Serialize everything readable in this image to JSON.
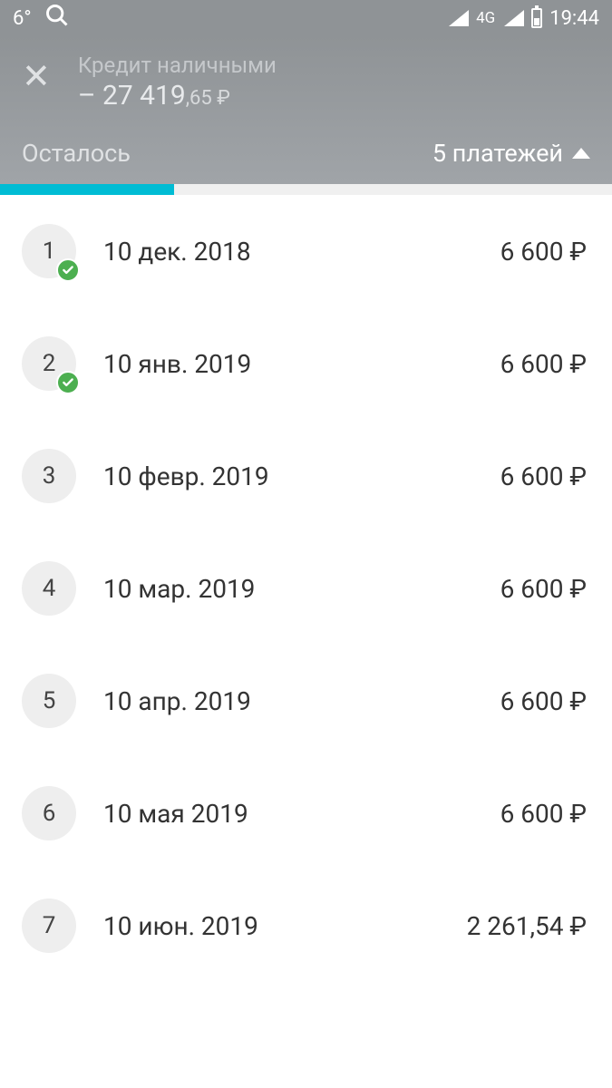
{
  "status_bar": {
    "temp": "6°",
    "network": "4G",
    "time": "19:44"
  },
  "header": {
    "subtitle": "Кредит наличными",
    "amount_main": "– 27 419",
    "amount_cents": ",65 ₽",
    "left_label": "Осталось",
    "right_label": "5 платежей"
  },
  "payments": [
    {
      "num": "1",
      "date": "10 дек. 2018",
      "amount": "6 600 ₽",
      "done": true
    },
    {
      "num": "2",
      "date": "10 янв. 2019",
      "amount": "6 600 ₽",
      "done": true
    },
    {
      "num": "3",
      "date": "10 февр. 2019",
      "amount": "6 600 ₽",
      "done": false
    },
    {
      "num": "4",
      "date": "10 мар. 2019",
      "amount": "6 600 ₽",
      "done": false
    },
    {
      "num": "5",
      "date": "10 апр. 2019",
      "amount": "6 600 ₽",
      "done": false
    },
    {
      "num": "6",
      "date": "10 мая 2019",
      "amount": "6 600 ₽",
      "done": false
    },
    {
      "num": "7",
      "date": "10 июн. 2019",
      "amount": "2 261,54 ₽",
      "done": false
    }
  ]
}
